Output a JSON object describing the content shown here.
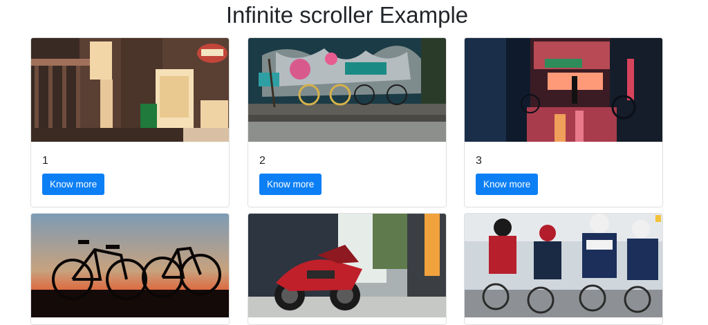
{
  "page": {
    "title": "Infinite scroller Example"
  },
  "cards": [
    {
      "number": "1",
      "button_label": "Know more",
      "image": "storefront-night-photo"
    },
    {
      "number": "2",
      "button_label": "Know more",
      "image": "graffiti-wall-bicycles-photo"
    },
    {
      "number": "3",
      "button_label": "Know more",
      "image": "neon-street-rain-photo"
    },
    {
      "image": "bicycle-silhouette-sunset-photo"
    },
    {
      "image": "red-motorcycle-photo"
    },
    {
      "image": "cycling-race-photo"
    }
  ],
  "colors": {
    "accent": "#0d7ff5",
    "card_border": "#dfdfdf",
    "text": "#212529"
  }
}
